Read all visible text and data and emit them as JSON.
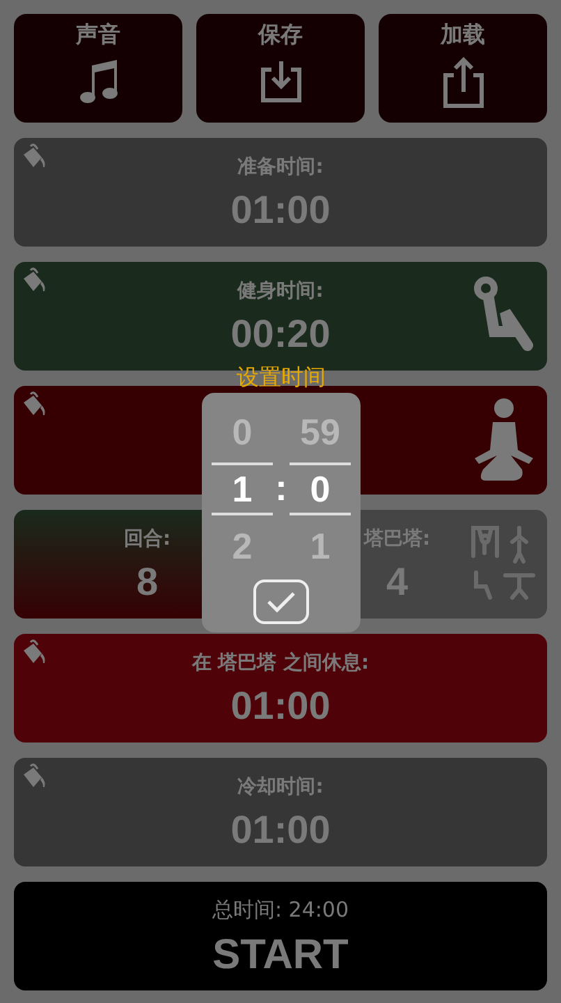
{
  "top_buttons": [
    {
      "label": "声音",
      "kind": "sound"
    },
    {
      "label": "保存",
      "kind": "save"
    },
    {
      "label": "加载",
      "kind": "load"
    }
  ],
  "cards": [
    {
      "kind": "prepare",
      "title": "准备时间:",
      "value": "01:00",
      "color": "#363636"
    },
    {
      "kind": "workout",
      "title": "健身时间:",
      "value": "00:20",
      "color": "#1a2a1c"
    },
    {
      "kind": "rest",
      "color": "#360003"
    },
    {
      "kind": "pair",
      "items": [
        {
          "kind": "rounds",
          "title": "回合:",
          "value": "8",
          "color": "#1a2a1c"
        },
        {
          "kind": "tabatas",
          "title": "塔巴塔:",
          "value": "4",
          "color": "#454545"
        }
      ]
    },
    {
      "kind": "rest_between",
      "title": "在 塔巴塔 之间休息:",
      "value": "01:00",
      "color": "#4f0308"
    },
    {
      "kind": "cooldown",
      "title": "冷却时间:",
      "value": "01:00",
      "color": "#363636"
    },
    {
      "kind": "start",
      "title": "总时间: 24:00",
      "value": "START",
      "color": "#000000"
    }
  ],
  "picker": {
    "title": "设置时间",
    "separator": ":",
    "minutes": [
      {
        "value": "0",
        "selected": false
      },
      {
        "value": "1",
        "selected": true
      },
      {
        "value": "2",
        "selected": false
      }
    ],
    "seconds": [
      {
        "value": "59",
        "selected": false
      },
      {
        "value": "0",
        "selected": true
      },
      {
        "value": "1",
        "selected": false
      }
    ]
  }
}
